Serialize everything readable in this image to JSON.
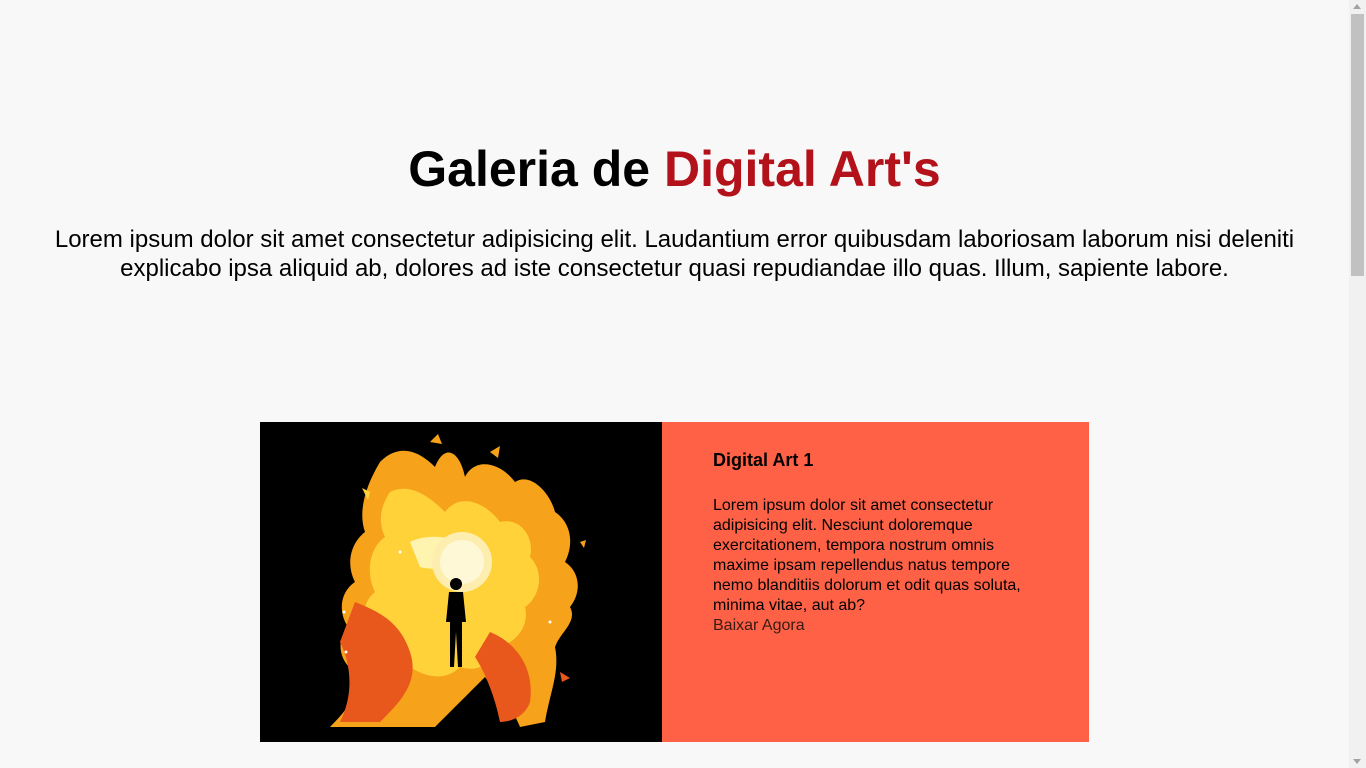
{
  "hero": {
    "title_part1": "Galeria de ",
    "title_accent": "Digital Art's",
    "description": "Lorem ipsum dolor sit amet consectetur adipisicing elit. Laudantium error quibusdam laboriosam laborum nisi deleniti explicabo ipsa aliquid ab, dolores ad iste consectetur quasi repudiandae illo quas. Illum, sapiente labore."
  },
  "card": {
    "title": "Digital Art 1",
    "text": "Lorem ipsum dolor sit amet consectetur adipisicing elit. Nesciunt doloremque exercitationem, tempora nostrum omnis maxime ipsam repellendus natus tempore nemo blanditiis dolorum et odit quas soluta, minima vitae, aut ab?",
    "link_label": "Baixar Agora"
  },
  "colors": {
    "accent": "#b3121a",
    "card_background": "#ff6147",
    "page_background": "#f8f8f8"
  }
}
